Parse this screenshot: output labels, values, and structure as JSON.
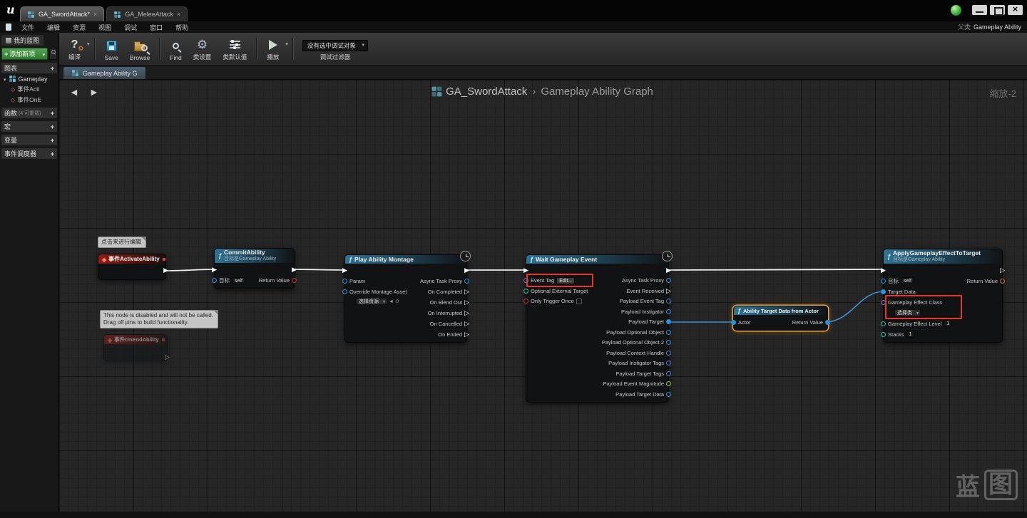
{
  "titlebar": {
    "tab1": "GA_SwordAttack*",
    "tab2": "GA_MeleeAttack"
  },
  "menubar": {
    "items": [
      "文件",
      "编辑",
      "资源",
      "视图",
      "调试",
      "窗口",
      "帮助"
    ],
    "parent_label": "父类",
    "parent_value": "Gameplay Ability"
  },
  "toolbar": {
    "compile": "编译",
    "save": "Save",
    "browse": "Browse",
    "find": "Find",
    "class_settings": "类设置",
    "class_defaults": "类默认值",
    "play": "播放",
    "debug_target": "没有选中调试对象",
    "debug_filter": "调试过滤器"
  },
  "sidebar": {
    "panel": "我的蓝图",
    "add_new": "添加新项",
    "graphs": "图表",
    "graph_name": "Gameplay",
    "event1": "事件Acti",
    "event2": "事件OnE",
    "functions": "函数",
    "functions_note": "(4 可重载)",
    "macros": "宏",
    "variables": "变量",
    "dispatchers": "事件调度器"
  },
  "doc": {
    "tab": "Gameplay Ability G",
    "crumb_root": "GA_SwordAttack",
    "crumb_sep": "›",
    "crumb_leaf": "Gameplay Ability Graph",
    "zoom": "缩放-2"
  },
  "graph": {
    "comment": "点击来进行编辑",
    "note1": "This node is disabled and will not be called.",
    "note2": "Drag off pins to build functionality.",
    "wm1": "蓝",
    "wm2": "图"
  },
  "nodes": {
    "event_activate": {
      "title": "事件ActivateAbility"
    },
    "event_end": {
      "title": "事件OnEndAbility"
    },
    "commit": {
      "title": "CommitAbility",
      "subtitle": "目标是Gameplay Ability",
      "target": "目标",
      "self": "self",
      "ret": "Return Value"
    },
    "montage": {
      "title": "Play Ability Montage",
      "param": "Param",
      "oma": "Override Montage Asset",
      "picker": "选择资源",
      "out": [
        "Async Task Proxy",
        "On Completed",
        "On Blend Out",
        "On Interrupted",
        "On Cancelled",
        "On Ended"
      ]
    },
    "wait": {
      "title": "Wait Gameplay Event",
      "event_tag": "Event Tag",
      "edit": "Edit...",
      "opt_target": "Optional External Target",
      "once": "Only Trigger Once",
      "out": [
        "Async Task Proxy",
        "Event Received",
        "Payload Event Tag",
        "Payload Instigator",
        "Payload Target",
        "Payload Optional Object",
        "Payload Optional Object 2",
        "Payload Context Handle",
        "Payload Instigator Tags",
        "Payload Target Tags",
        "Payload Event Magnitude",
        "Payload Target Data"
      ]
    },
    "target_data": {
      "title": "Ability Target Data from Actor",
      "actor": "Actor",
      "ret": "Return Value"
    },
    "apply": {
      "title": "ApplyGameplayEffectToTarget",
      "subtitle": "目标是Gameplay Ability",
      "target": "目标",
      "self": "self",
      "tdata": "Target Data",
      "eclass": "Gameplay Effect Class",
      "picker": "选择类",
      "elevel": "Gameplay Effect Level",
      "elevel_val": "1",
      "stacks": "Stacks",
      "stacks_val": "1",
      "ret": "Return Value"
    }
  }
}
